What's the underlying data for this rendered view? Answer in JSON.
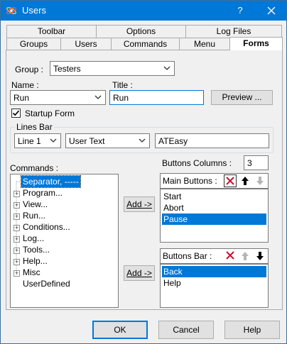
{
  "window": {
    "title": "Users",
    "help_glyph": "?",
    "close_glyph": "✕"
  },
  "tabs_row1": [
    {
      "label": "Toolbar"
    },
    {
      "label": "Options"
    },
    {
      "label": "Log Files"
    }
  ],
  "tabs_row2": [
    {
      "label": "Groups"
    },
    {
      "label": "Users"
    },
    {
      "label": "Commands"
    },
    {
      "label": "Menu"
    },
    {
      "label": "Forms",
      "active": true
    }
  ],
  "form": {
    "group_label": "Group :",
    "group_value": "Testers",
    "name_label": "Name :",
    "name_value": "Run",
    "title_label": "Title :",
    "title_value": "Run",
    "preview_button": "Preview ...",
    "startup_label": "Startup Form",
    "startup_checked": true,
    "lines_bar_label": "Lines Bar",
    "line_combo_value": "Line 1",
    "line_type_value": "User Text",
    "line_text_value": "ATEasy"
  },
  "commands": {
    "label": "Commands :",
    "items": [
      {
        "label": "Separator, -----",
        "expandable": false,
        "selected": true
      },
      {
        "label": "Program...",
        "expandable": true
      },
      {
        "label": "View...",
        "expandable": true
      },
      {
        "label": "Run...",
        "expandable": true
      },
      {
        "label": "Conditions...",
        "expandable": true
      },
      {
        "label": "Log...",
        "expandable": true
      },
      {
        "label": "Tools...",
        "expandable": true
      },
      {
        "label": "Help...",
        "expandable": true
      },
      {
        "label": "Misc",
        "expandable": true
      },
      {
        "label": "UserDefined",
        "expandable": false
      }
    ]
  },
  "add_buttons": {
    "add_main": "Add ->",
    "add_bar": "Add ->"
  },
  "buttons_columns": {
    "label": "Buttons Columns :",
    "value": "3"
  },
  "main_buttons": {
    "label": "Main Buttons :",
    "items": [
      {
        "label": "Start"
      },
      {
        "label": "Abort"
      },
      {
        "label": "Pause",
        "selected": true
      }
    ]
  },
  "buttons_bar": {
    "label": "Buttons Bar :",
    "items": [
      {
        "label": "Back",
        "selected": true
      },
      {
        "label": "Help"
      }
    ]
  },
  "footer": {
    "ok": "OK",
    "cancel": "Cancel",
    "help": "Help"
  },
  "colors": {
    "titlebar": "#0078d7",
    "selection": "#0078d7",
    "delete_icon": "#c8102e"
  },
  "icons": {
    "app": "atom-icon",
    "delete": "delete-x-icon",
    "move_up": "arrow-up-icon",
    "move_down": "arrow-down-icon"
  }
}
